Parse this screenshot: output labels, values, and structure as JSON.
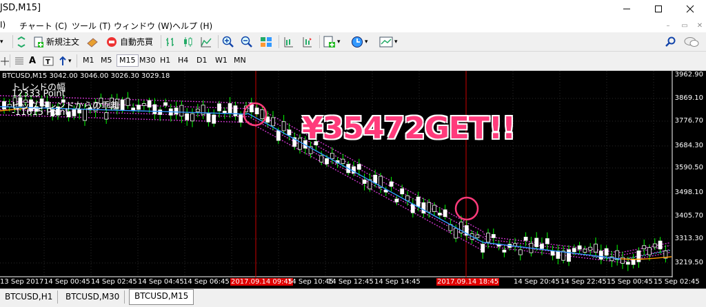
{
  "window": {
    "title": "JSD,M15]"
  },
  "menu": {
    "items": [
      "I)",
      "チャート (C)",
      "ツール (T)",
      "ウィンドウ (W)",
      "ヘルプ (H)"
    ]
  },
  "toolbar": {
    "new_order": "新規注文",
    "auto_trade": "自動売買"
  },
  "timeframes": [
    "M1",
    "M5",
    "M15",
    "M30",
    "H1",
    "H4",
    "D1",
    "W1",
    "MN"
  ],
  "active_timeframe": "M15",
  "chart": {
    "header": "BTCUSD,M15  3042.00 3046.00 3026.30 3029.18",
    "indicators": [
      "トレンドの幅",
      "12333 Point",
      "ビッグトレンドからの乖離",
      "-11615 Point"
    ],
    "profit_text": "¥35472GET!!",
    "price_labels": [
      "3962.90",
      "3869.10",
      "3776.70",
      "3684.30",
      "3590.50",
      "3498.10",
      "3405.70",
      "3313.30",
      "3219.50"
    ],
    "time_labels": [
      "13 Sep 2017",
      "14 Sep 00:45",
      "14 Sep 02:45",
      "14 Sep 04:45",
      "14 Sep 06:45",
      "2017.09.14 09:45",
      "14 Sep 10:45",
      "14 Sep 12:45",
      "14 Sep 14:45",
      "2017.09.14 18:45",
      "14 Sep 20:45",
      "14 Sep 22:45",
      "15 Sep 00:45",
      "15 Sep 02:45"
    ],
    "highlighted_times": [
      "2017.09.14 09:45",
      "2017.09.14 18:45"
    ],
    "colors": {
      "background": "#000000",
      "bull_candle": "#ffffff",
      "bear_candle": "#ffffff",
      "wick": "#00ff00",
      "ma": "#3399ff",
      "band": "#cc33cc",
      "circle": "#ff3b7b",
      "profit": "#ff3b7b",
      "marker_line": "#cc0000"
    }
  },
  "tabs": [
    "BTCUSD,H1",
    "BTCUSD,M30",
    "BTCUSD,M15"
  ],
  "active_tab": "BTCUSD,M15"
}
